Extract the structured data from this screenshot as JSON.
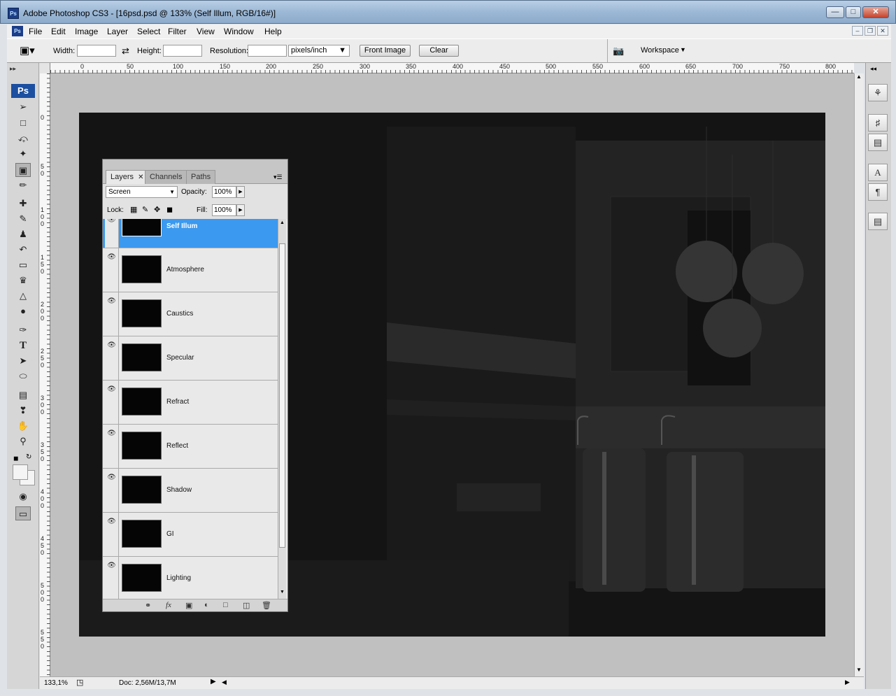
{
  "window": {
    "title": "Adobe Photoshop CS3 - [16psd.psd @ 133% (Self Illum, RGB/16#)]",
    "app_icon": "Ps",
    "controls": [
      "minimize",
      "restore",
      "close"
    ]
  },
  "menu": {
    "items": [
      "File",
      "Edit",
      "Image",
      "Layer",
      "Select",
      "Filter",
      "View",
      "Window",
      "Help"
    ]
  },
  "options": {
    "width_label": "Width:",
    "height_label": "Height:",
    "resolution_label": "Resolution:",
    "width_value": "",
    "height_value": "",
    "resolution_value": "",
    "unit_select": "pixels/inch",
    "front_image_label": "Front Image",
    "clear_label": "Clear",
    "workspace_label": "Workspace"
  },
  "rulers": {
    "h_ticks": [
      "0",
      "50",
      "100",
      "150",
      "200",
      "250",
      "300",
      "350",
      "400",
      "450",
      "500",
      "550",
      "600",
      "650",
      "700",
      "750",
      "800"
    ],
    "v_ticks": [
      "0",
      "5",
      "0",
      "5",
      "1",
      "0",
      "0",
      "1",
      "5",
      "0",
      "2",
      "0",
      "0",
      "2",
      "5",
      "0",
      "3",
      "0",
      "0",
      "3",
      "5",
      "0",
      "4",
      "0",
      "0",
      "4",
      "5",
      "0",
      "5",
      "0",
      "0",
      "5",
      "5",
      "0"
    ]
  },
  "layers_panel": {
    "tabs": [
      "Layers",
      "Channels",
      "Paths"
    ],
    "blend_mode": "Screen",
    "opacity_label": "Opacity:",
    "opacity_value": "100%",
    "lock_label": "Lock:",
    "fill_label": "Fill:",
    "fill_value": "100%",
    "layers": [
      {
        "name": "Self Illum",
        "visible": true,
        "selected": true
      },
      {
        "name": "Atmosphere",
        "visible": true,
        "selected": false
      },
      {
        "name": "Caustics",
        "visible": true,
        "selected": false
      },
      {
        "name": "Specular",
        "visible": true,
        "selected": false
      },
      {
        "name": "Refract",
        "visible": true,
        "selected": false
      },
      {
        "name": "Reflect",
        "visible": true,
        "selected": false
      },
      {
        "name": "Shadow",
        "visible": true,
        "selected": false
      },
      {
        "name": "GI",
        "visible": true,
        "selected": false
      },
      {
        "name": "Lighting",
        "visible": true,
        "selected": false
      }
    ]
  },
  "status": {
    "zoom": "133,1%",
    "doc": "Doc: 2,56M/13,7M"
  },
  "colors": {
    "selected_layer": "#3b99ef",
    "titlebar": "#9cb8d6",
    "canvas_bg": "#c0c0c0"
  }
}
